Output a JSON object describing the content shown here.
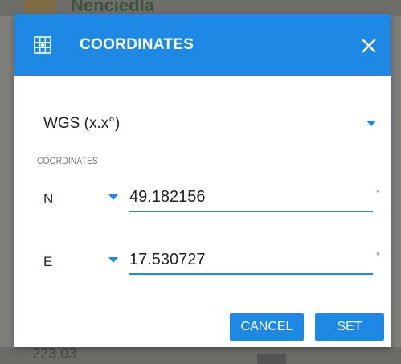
{
  "background": {
    "top_text": "Nenciedla",
    "bottom_text": "223.03"
  },
  "dialog": {
    "title": "COORDINATES",
    "title_icon": "grid-icon",
    "close_icon": "close-icon",
    "coordinate_system": "WGS (x.x°)",
    "section_label": "COORDINATES",
    "latitude": {
      "letter": "N",
      "value": "49.182156",
      "unit": "°"
    },
    "longitude": {
      "letter": "E",
      "value": "17.530727",
      "unit": "°"
    },
    "buttons": {
      "cancel": "CANCEL",
      "set": "SET"
    }
  },
  "colors": {
    "accent": "#1e88e5",
    "text": "#212121",
    "muted": "#757575"
  }
}
